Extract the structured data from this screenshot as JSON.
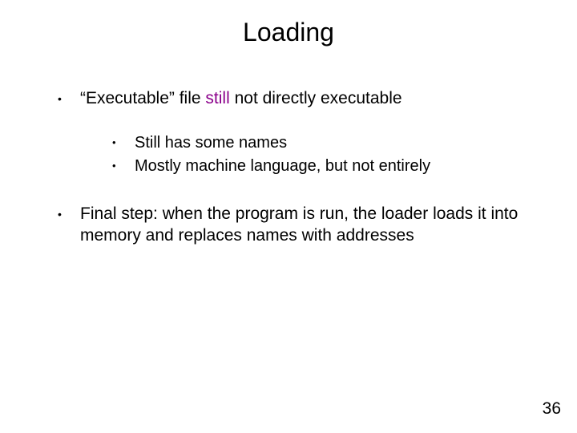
{
  "title": "Loading",
  "bullets": {
    "b1_pre": "“Executable” file ",
    "b1_accent": "still",
    "b1_post": " not directly executable",
    "b1_sub1": "Still has some names",
    "b1_sub2": "Mostly machine language, but not entirely",
    "b2": "Final step: when the program is run, the loader loads it into memory and replaces names with addresses"
  },
  "page_number": "36"
}
